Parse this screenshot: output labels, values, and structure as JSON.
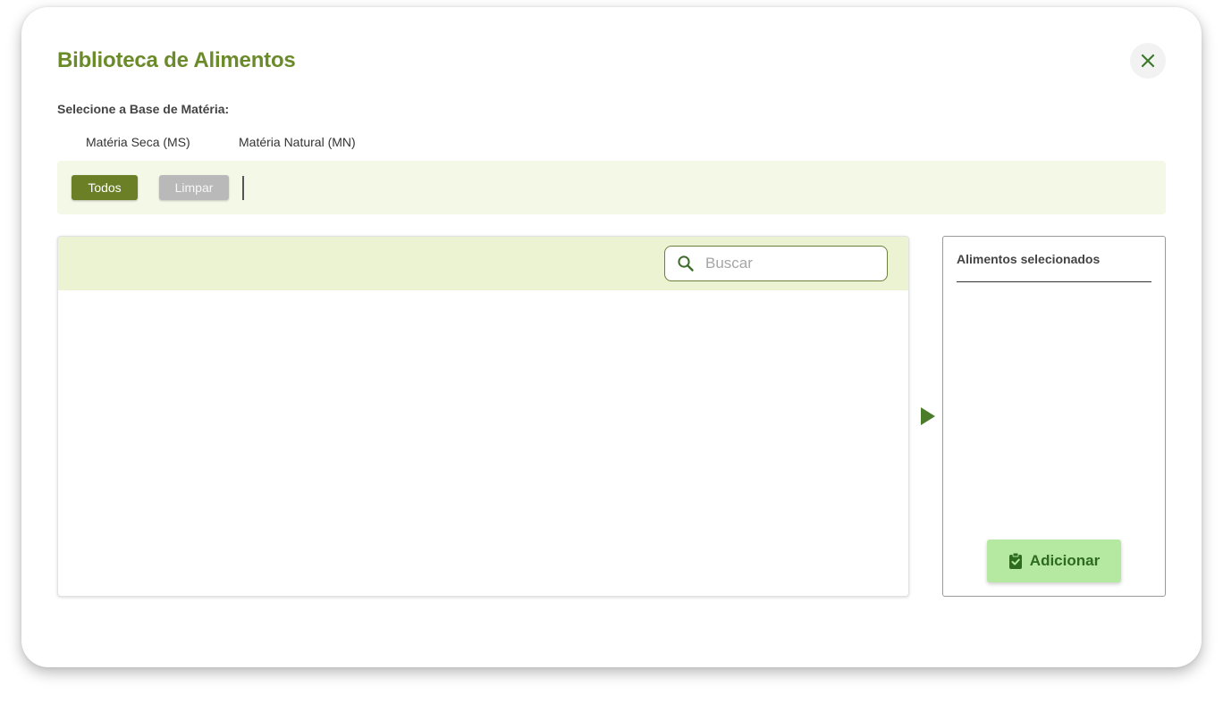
{
  "modal": {
    "title": "Biblioteca de Alimentos",
    "close_icon": "close-icon"
  },
  "base_materia": {
    "label": "Selecione a Base de Matéria:",
    "options": [
      "Matéria Seca (MS)",
      "Matéria Natural (MN)"
    ]
  },
  "filter_bar": {
    "todos_label": "Todos",
    "limpar_label": "Limpar"
  },
  "food_table": {
    "search_placeholder": "Buscar",
    "search_value": "",
    "search_icon": "search-icon",
    "rows": []
  },
  "transfer": {
    "icon": "play-arrow-icon"
  },
  "selected_panel": {
    "title": "Alimentos selecionados",
    "items": [],
    "add_label": "Adicionar",
    "add_icon": "clipboard-check-icon"
  },
  "colors": {
    "title": "#6b8a2a",
    "todos_bg": "#6b7f27",
    "limpar_bg": "#b9b9b9",
    "filter_bg": "#f4f8e7",
    "table_head_bg": "#ecf3d3",
    "add_bg": "#b5e8a1",
    "add_text": "#2d6b1e",
    "arrow": "#4a7c2a"
  }
}
